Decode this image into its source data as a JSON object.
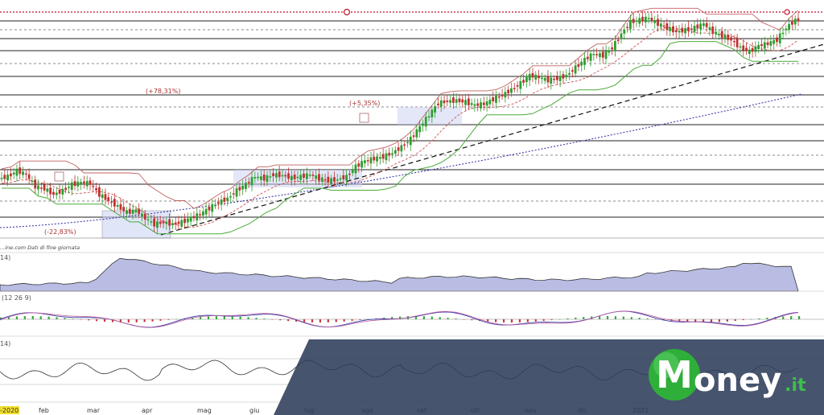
{
  "chart_data": [
    {
      "type": "candlestick",
      "title": "",
      "source_note": "...ine.com  Dati di fine giornata",
      "x_labels": [
        "-2020",
        "feb",
        "mar",
        "apr",
        "mag",
        "giu",
        "lug",
        "ago",
        "set",
        "ott",
        "nov",
        "dic",
        "2021"
      ],
      "annotations": [
        "(+78,31%)",
        "(+5,35%)",
        "(-22,83%)"
      ],
      "price_path": [
        43,
        43.5,
        45,
        44,
        41,
        40.5,
        39,
        40,
        41.5,
        42,
        41.8,
        39,
        37.5,
        36,
        34.5,
        35,
        33,
        31.5,
        32,
        31.5,
        32,
        33,
        34,
        35.5,
        37,
        38,
        40,
        41.5,
        43.5,
        43,
        44,
        43.8,
        43.2,
        43.5,
        44,
        43,
        42.5,
        42.8,
        43.5,
        46,
        47.5,
        48,
        48.5,
        49.5,
        51,
        53,
        56,
        59,
        62,
        62.5,
        62.7,
        62.3,
        61.5,
        61.8,
        63,
        64,
        65.5,
        67,
        69,
        68.5,
        67.8,
        68.2,
        69,
        71,
        73,
        74.5,
        74,
        76,
        79.5,
        82.5,
        83,
        83.5,
        82,
        81,
        80,
        80.5,
        81,
        82,
        80,
        79,
        78,
        76,
        75,
        76.5,
        77,
        78,
        81,
        83
      ],
      "trend_lines": [
        "support-dashed",
        "ma200-dotted"
      ]
    },
    {
      "type": "area",
      "label": "14)",
      "indicator": "volatility"
    },
    {
      "type": "bar",
      "label": "(12 26 9)",
      "indicator": "MACD"
    },
    {
      "type": "line",
      "label": "14)",
      "indicator": "oscillator"
    }
  ],
  "colors": {
    "bull": "#2e9e2e",
    "bear": "#c23030",
    "resistance": "#c0102a",
    "ma_short": "#d05050",
    "ma_long": "#3a3aa8",
    "trail": "#4caa3a",
    "vol_fill": "#b9bde4",
    "macd_pos": "#39a83d",
    "macd_neg": "#c83c3c",
    "watermark_bg": "#2e3c5a"
  },
  "watermark": {
    "brand": "Money",
    "suffix": ".it",
    "logo_letter": "M",
    "logo_icon": "green-sphere-icon"
  }
}
